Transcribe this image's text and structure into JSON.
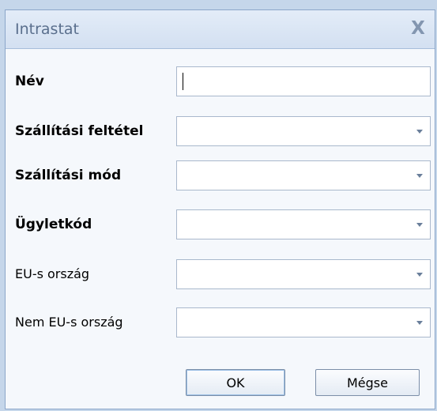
{
  "window": {
    "title": "Intrastat",
    "close_symbol": "X"
  },
  "form": {
    "fields": [
      {
        "label": "Név",
        "type": "text",
        "value": ""
      },
      {
        "label": "Szállítási feltétel",
        "type": "select",
        "value": ""
      },
      {
        "label": "Szállítási mód",
        "type": "select",
        "value": ""
      },
      {
        "label": "Ügyletkód",
        "type": "select",
        "value": ""
      },
      {
        "label": "EU-s ország",
        "type": "select",
        "value": ""
      },
      {
        "label": "Nem EU-s ország",
        "type": "select",
        "value": ""
      }
    ]
  },
  "buttons": {
    "ok": "OK",
    "cancel": "Mégse"
  },
  "icons": {
    "close": "close-icon",
    "dropdown": "chevron-down-icon"
  }
}
